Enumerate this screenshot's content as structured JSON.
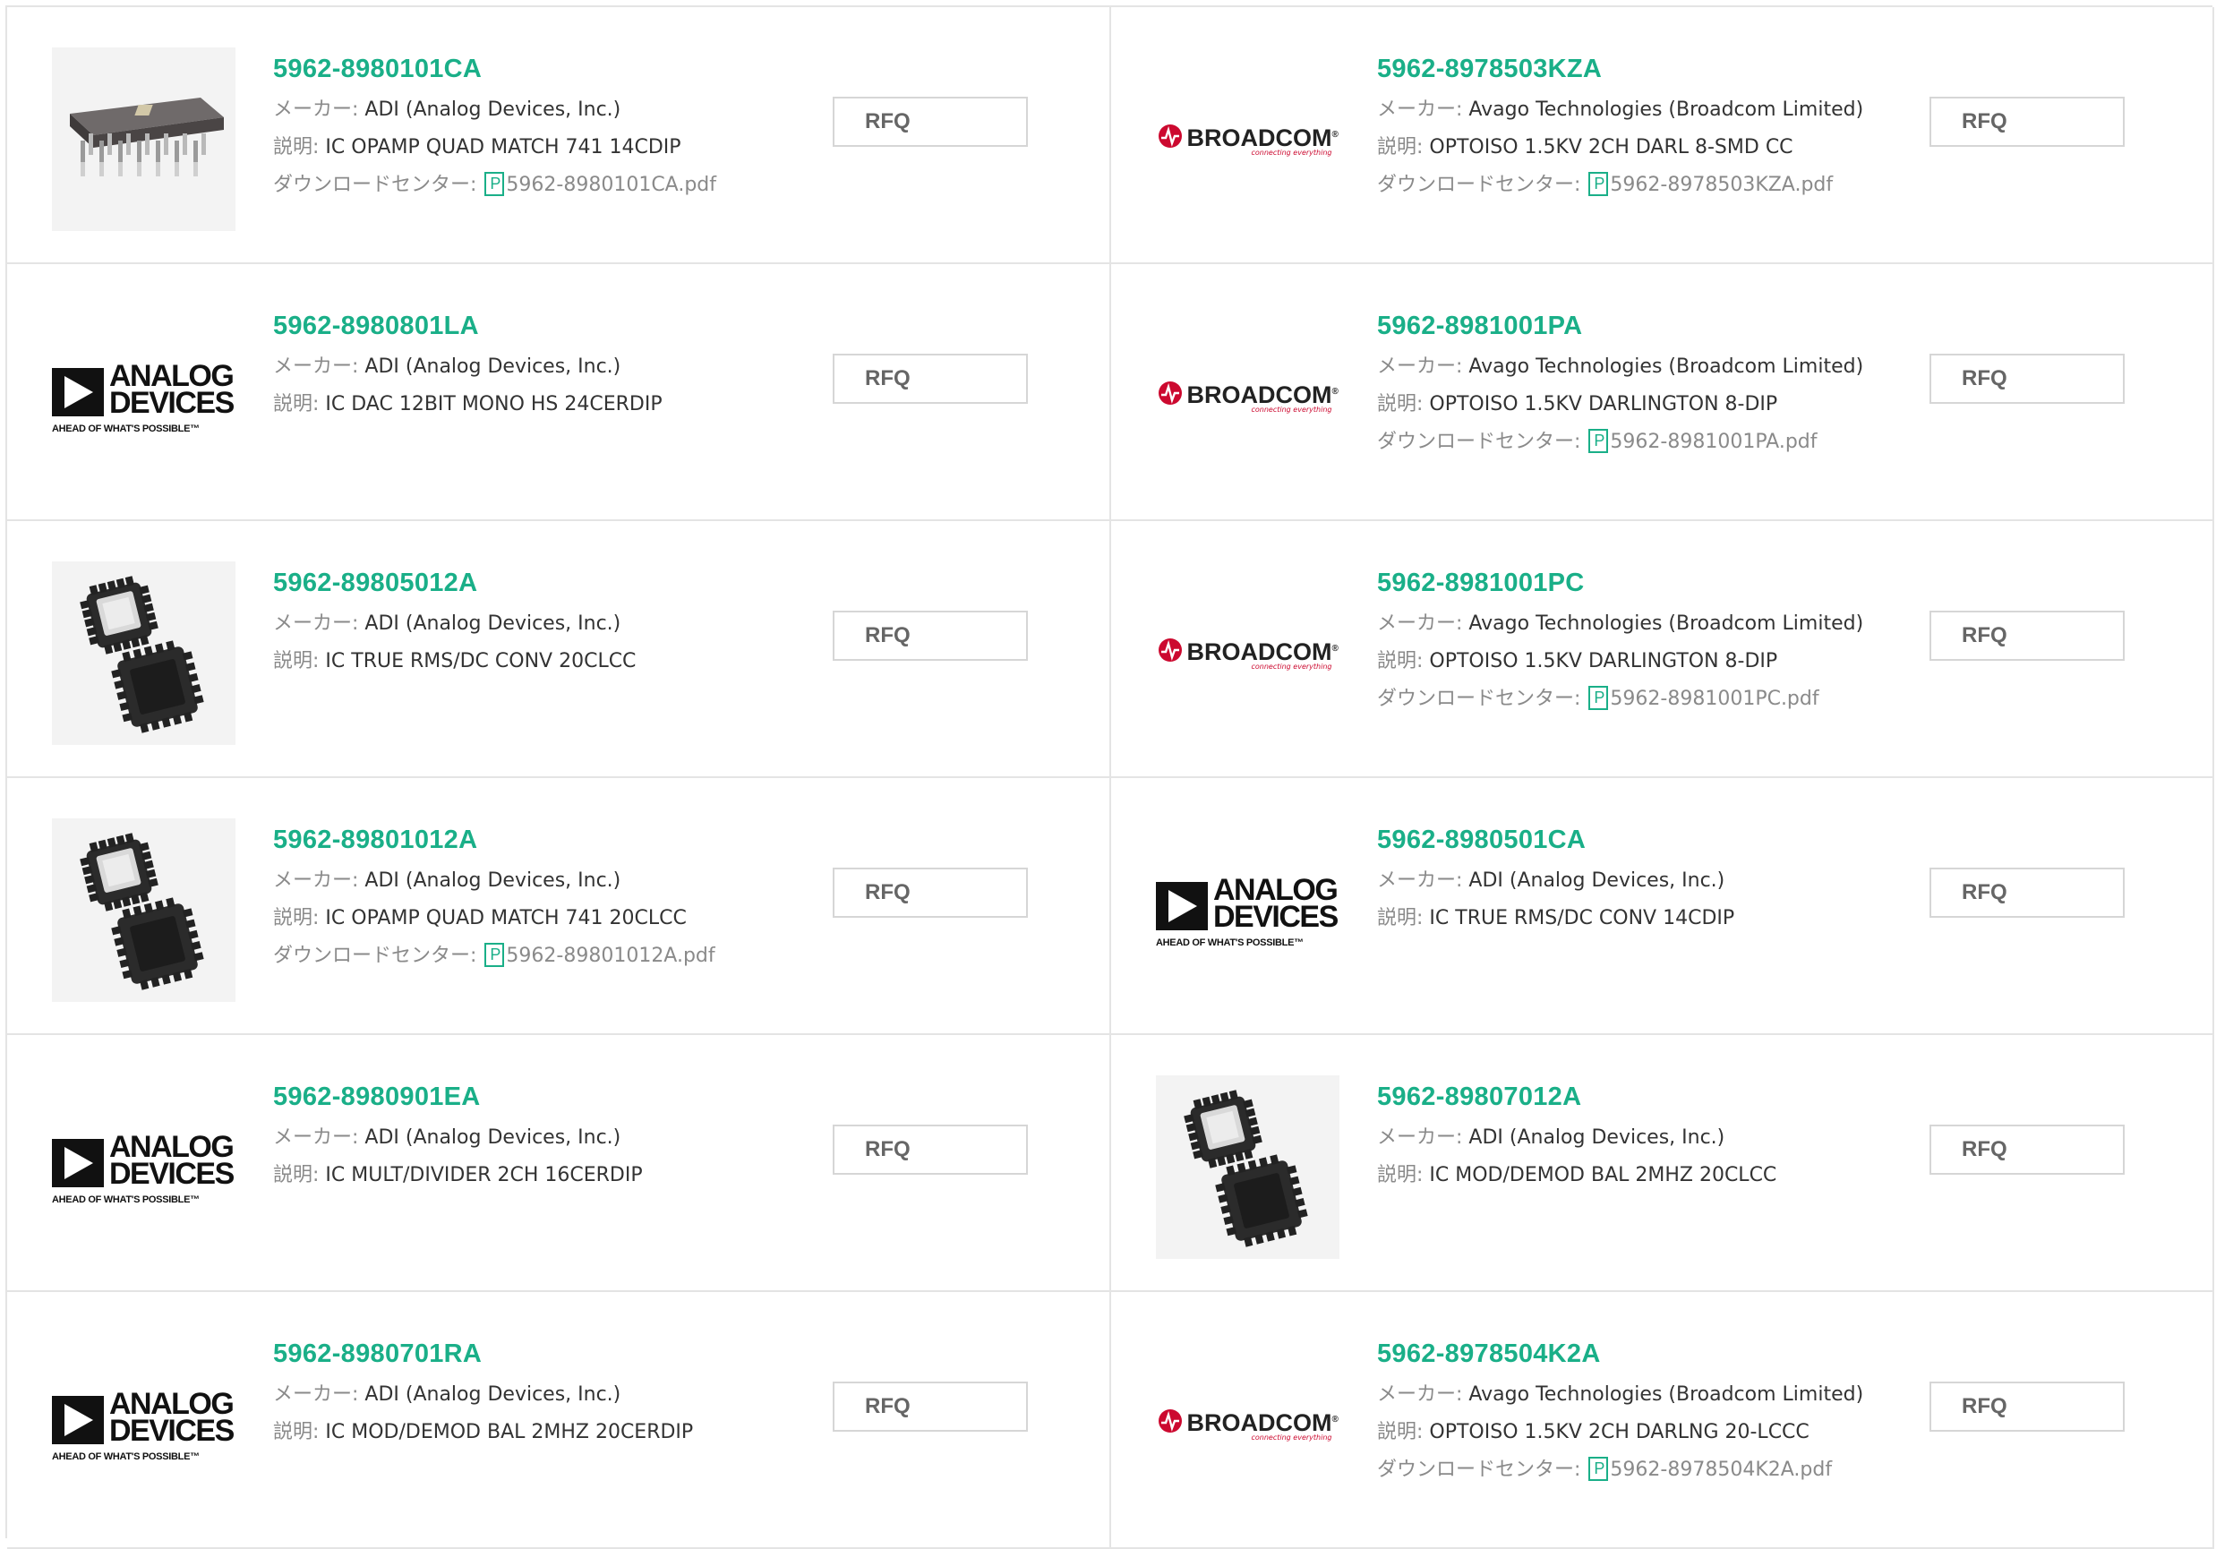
{
  "labels": {
    "maker": "メーカー: ",
    "desc": "説明: ",
    "download": "ダウンロードセンター: ",
    "rfq": "RFQ",
    "pdf_glyph": "P"
  },
  "logos": {
    "adi": {
      "line1": "ANALOG",
      "line2": "DEVICES",
      "tagline": "AHEAD OF WHAT'S POSSIBLE™"
    },
    "broadcom": {
      "name": "BROADCOM",
      "tm": "®",
      "tagline": "connecting everything"
    }
  },
  "colors": {
    "accent": "#1aaf88",
    "adi_red": "#cc092f"
  },
  "products": [
    {
      "part": "5962-8980101CA",
      "maker": "ADI (Analog Devices, Inc.)",
      "desc": "IC OPAMP QUAD MATCH 741 14CDIP",
      "pdf": "5962-8980101CA.pdf",
      "thumb": "dip-photo"
    },
    {
      "part": "5962-8978503KZA",
      "maker": "Avago Technologies (Broadcom Limited)",
      "desc": "OPTOISO 1.5KV 2CH DARL 8-SMD CC",
      "pdf": "5962-8978503KZA.pdf",
      "thumb": "broadcom-logo"
    },
    {
      "part": "5962-8980801LA",
      "maker": "ADI (Analog Devices, Inc.)",
      "desc": "IC DAC 12BIT MONO HS 24CERDIP",
      "pdf": null,
      "thumb": "adi-logo"
    },
    {
      "part": "5962-8981001PA",
      "maker": "Avago Technologies (Broadcom Limited)",
      "desc": "OPTOISO 1.5KV DARLINGTON 8-DIP",
      "pdf": "5962-8981001PA.pdf",
      "thumb": "broadcom-logo"
    },
    {
      "part": "5962-89805012A",
      "maker": "ADI (Analog Devices, Inc.)",
      "desc": "IC TRUE RMS/DC CONV 20CLCC",
      "pdf": null,
      "thumb": "lcc-photo"
    },
    {
      "part": "5962-8981001PC",
      "maker": "Avago Technologies (Broadcom Limited)",
      "desc": "OPTOISO 1.5KV DARLINGTON 8-DIP",
      "pdf": "5962-8981001PC.pdf",
      "thumb": "broadcom-logo"
    },
    {
      "part": "5962-89801012A",
      "maker": "ADI (Analog Devices, Inc.)",
      "desc": "IC OPAMP QUAD MATCH 741 20CLCC",
      "pdf": "5962-89801012A.pdf",
      "thumb": "lcc-photo"
    },
    {
      "part": "5962-8980501CA",
      "maker": "ADI (Analog Devices, Inc.)",
      "desc": "IC TRUE RMS/DC CONV 14CDIP",
      "pdf": null,
      "thumb": "adi-logo"
    },
    {
      "part": "5962-8980901EA",
      "maker": "ADI (Analog Devices, Inc.)",
      "desc": "IC MULT/DIVIDER 2CH 16CERDIP",
      "pdf": null,
      "thumb": "adi-logo"
    },
    {
      "part": "5962-89807012A",
      "maker": "ADI (Analog Devices, Inc.)",
      "desc": "IC MOD/DEMOD BAL 2MHZ 20CLCC",
      "pdf": null,
      "thumb": "lcc-photo"
    },
    {
      "part": "5962-8980701RA",
      "maker": "ADI (Analog Devices, Inc.)",
      "desc": "IC MOD/DEMOD BAL 2MHZ 20CERDIP",
      "pdf": null,
      "thumb": "adi-logo"
    },
    {
      "part": "5962-8978504K2A",
      "maker": "Avago Technologies (Broadcom Limited)",
      "desc": "OPTOISO 1.5KV 2CH DARLNG 20-LCCC",
      "pdf": "5962-8978504K2A.pdf",
      "thumb": "broadcom-logo"
    }
  ]
}
